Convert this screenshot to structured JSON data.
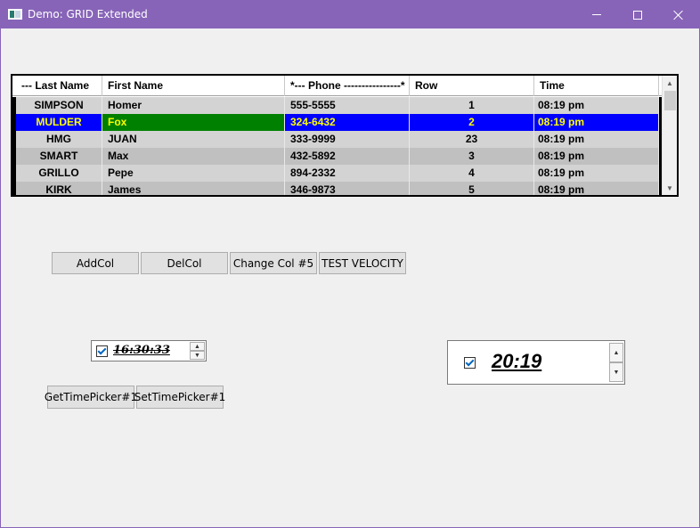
{
  "window": {
    "title": "Demo: GRID Extended"
  },
  "grid": {
    "columns": [
      "--- Last Name",
      "First Name",
      "*--- Phone ----------------*",
      "Row",
      "Time"
    ],
    "rows": [
      {
        "last": "SIMPSON",
        "first": "Homer",
        "phone": "555-5555",
        "row": "1",
        "time": "08:19 pm",
        "bg": "#d3d3d3",
        "fg": "#000000"
      },
      {
        "last": "MULDER",
        "first": "Fox",
        "phone": "324-6432",
        "row": "2",
        "time": "08:19 pm",
        "bg": "#0000ff",
        "fg": "#ffff00",
        "first_bg": "#008000",
        "selected": true
      },
      {
        "last": "HMG",
        "first": "JUAN",
        "phone": "333-9999",
        "row": "23",
        "time": "08:19 pm",
        "bg": "#d3d3d3",
        "fg": "#000000"
      },
      {
        "last": "SMART",
        "first": "Max",
        "phone": "432-5892",
        "row": "3",
        "time": "08:19 pm",
        "bg": "#c0c0c0",
        "fg": "#000000"
      },
      {
        "last": "GRILLO",
        "first": "Pepe",
        "phone": "894-2332",
        "row": "4",
        "time": "08:19 pm",
        "bg": "#d3d3d3",
        "fg": "#000000"
      },
      {
        "last": "KIRK",
        "first": "James",
        "phone": "346-9873",
        "row": "5",
        "time": "08:19 pm",
        "bg": "#c0c0c0",
        "fg": "#000000"
      }
    ]
  },
  "buttons": {
    "add_col": "AddCol",
    "del_col": "DelCol",
    "change_col": "Change Col #5",
    "test_velocity": "TEST VELOCITY",
    "get_time_picker": "GetTimePicker#1",
    "set_time_picker": "SetTimePicker#1"
  },
  "time_picker_1": {
    "value": "16:30:33",
    "checked": true
  },
  "time_picker_2": {
    "value": "20:19",
    "checked": true
  },
  "colors": {
    "titlebar": "#8764b8",
    "selected_row": "#0000ff",
    "selected_cell": "#008000",
    "selected_text": "#ffff00"
  }
}
